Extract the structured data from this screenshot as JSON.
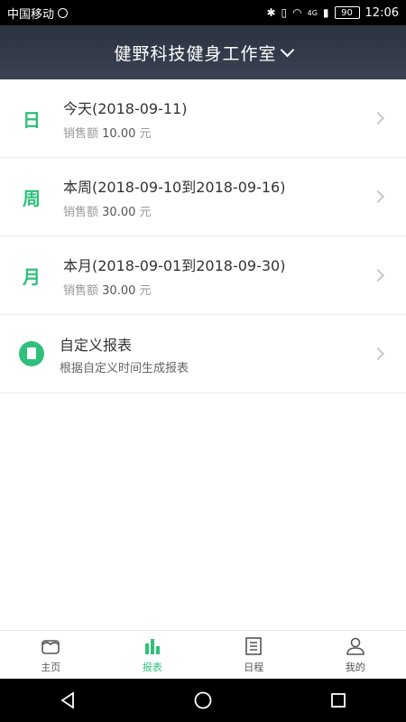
{
  "status_bar": {
    "carrier": "中国移动",
    "network": "4G",
    "battery": "90",
    "time": "12:06"
  },
  "header": {
    "title": "健野科技健身工作室"
  },
  "reports": [
    {
      "icon": "日",
      "title": "今天(2018-09-11)",
      "sales_label": "销售额",
      "sales_value": "10.00",
      "unit": "元"
    },
    {
      "icon": "周",
      "title": "本周(2018-09-10到2018-09-16)",
      "sales_label": "销售额",
      "sales_value": "30.00",
      "unit": "元"
    },
    {
      "icon": "月",
      "title": "本月(2018-09-01到2018-09-30)",
      "sales_label": "销售额",
      "sales_value": "30.00",
      "unit": "元"
    }
  ],
  "custom_report": {
    "title": "自定义报表",
    "subtitle": "根据自定义时间生成报表"
  },
  "tabs": [
    {
      "label": "主页",
      "icon": "home-icon"
    },
    {
      "label": "报表",
      "icon": "chart-icon",
      "active": true
    },
    {
      "label": "日程",
      "icon": "schedule-icon"
    },
    {
      "label": "我的",
      "icon": "user-icon"
    }
  ],
  "colors": {
    "accent": "#2ec07a",
    "header": "#2b3240"
  }
}
